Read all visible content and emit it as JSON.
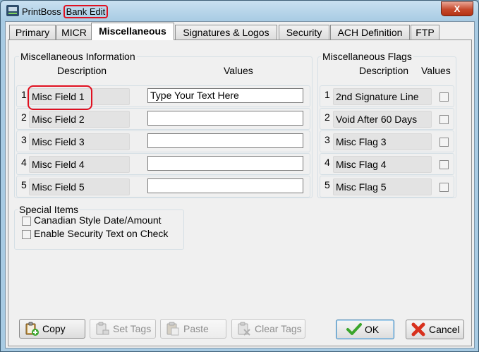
{
  "window": {
    "app_name": "PrintBoss",
    "title": "Bank Edit",
    "close_glyph": "X"
  },
  "tabs": [
    {
      "label": "Primary"
    },
    {
      "label": "MICR"
    },
    {
      "label": "Miscellaneous"
    },
    {
      "label": "Signatures & Logos"
    },
    {
      "label": "Security"
    },
    {
      "label": "ACH Definition"
    },
    {
      "label": "FTP"
    }
  ],
  "active_tab": "Miscellaneous",
  "misc_info": {
    "title": "Miscellaneous Information",
    "desc_header": "Description",
    "values_header": "Values",
    "rows": [
      {
        "num": "1",
        "desc": "Misc Field 1",
        "value": "Type Your Text Here"
      },
      {
        "num": "2",
        "desc": "Misc Field 2",
        "value": ""
      },
      {
        "num": "3",
        "desc": "Misc Field 3",
        "value": ""
      },
      {
        "num": "4",
        "desc": "Misc Field 4",
        "value": ""
      },
      {
        "num": "5",
        "desc": "Misc Field 5",
        "value": ""
      }
    ]
  },
  "misc_flags": {
    "title": "Miscellaneous Flags",
    "desc_header": "Description",
    "values_header": "Values",
    "rows": [
      {
        "num": "1",
        "desc": "2nd Signature Line",
        "checked": false
      },
      {
        "num": "2",
        "desc": "Void After 60 Days",
        "checked": false
      },
      {
        "num": "3",
        "desc": "Misc Flag 3",
        "checked": false
      },
      {
        "num": "4",
        "desc": "Misc Flag 4",
        "checked": false
      },
      {
        "num": "5",
        "desc": "Misc Flag 5",
        "checked": false
      }
    ]
  },
  "special_items": {
    "title": "Special Items",
    "items": [
      {
        "label": "Canadian Style Date/Amount",
        "checked": false
      },
      {
        "label": "Enable Security Text on Check",
        "checked": false
      }
    ]
  },
  "buttons": {
    "copy": "Copy",
    "set_tags": "Set Tags",
    "paste": "Paste",
    "clear_tags": "Clear Tags",
    "ok": "OK",
    "cancel": "Cancel"
  },
  "colors": {
    "highlight": "#e01020",
    "ok_check": "#3aa52c",
    "cancel_x": "#d8301c"
  }
}
